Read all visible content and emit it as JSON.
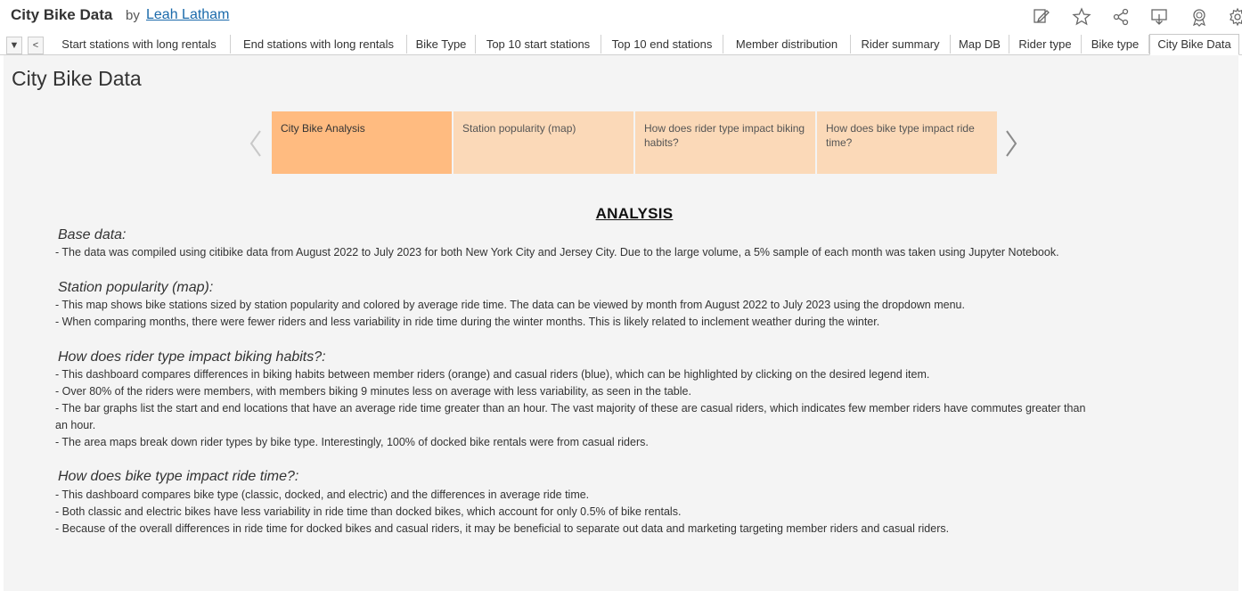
{
  "header": {
    "title": "City Bike Data",
    "by": "by",
    "author": "Leah Latham"
  },
  "toolbar_icons": [
    "edit-icon",
    "star-icon",
    "share-icon",
    "download-icon",
    "award-icon",
    "settings-icon"
  ],
  "tabs": [
    {
      "label": "Start stations with long rentals"
    },
    {
      "label": "End stations with long rentals"
    },
    {
      "label": "Bike Type"
    },
    {
      "label": "Top 10 start stations"
    },
    {
      "label": "Top 10 end stations"
    },
    {
      "label": "Member distribution"
    },
    {
      "label": "Rider summary"
    },
    {
      "label": "Map DB"
    },
    {
      "label": "Rider type"
    },
    {
      "label": "Bike type"
    },
    {
      "label": "City Bike Data",
      "active": true
    }
  ],
  "tab_controls": {
    "menu": "▼",
    "prev": "<"
  },
  "dashboard": {
    "title": "City Bike Data",
    "story_points": [
      {
        "label": "City Bike Analysis",
        "active": true
      },
      {
        "label": "Station popularity (map)"
      },
      {
        "label": "How does rider type impact biking habits?"
      },
      {
        "label": "How does bike type impact ride time?"
      }
    ],
    "analysis": {
      "heading": "ANALYSIS",
      "sections": [
        {
          "title": "Base data:",
          "lines": [
            "-  The data was compiled using citibike data from August 2022 to July 2023 for both New York City and Jersey City.  Due to the large volume, a 5% sample of each month was taken using Jupyter Notebook."
          ]
        },
        {
          "title": "Station popularity (map):",
          "lines": [
            "-  This map shows bike stations sized by station popularity and colored by average ride time. The data can be viewed by month from August 2022 to July 2023 using the dropdown menu.",
            "-  When comparing months, there were fewer riders and less variability in ride time during the winter months. This is likely related to inclement weather during the winter."
          ]
        },
        {
          "title": "How does rider type impact biking habits?:",
          "lines": [
            "-  This dashboard compares differences in biking habits between member riders (orange) and casual riders (blue), which can be highlighted by clicking on the desired legend item.",
            "-  Over 80% of the riders were members, with members biking 9 minutes less on average with less variability, as seen in the table.",
            "-  The bar graphs list the start and end locations that have an average ride time greater than an hour.  The vast majority of these are casual riders, which indicates few member riders have commutes greater than",
            "an hour.",
            "-  The area maps break down rider types by bike type.  Interestingly, 100% of docked bike rentals were from casual riders."
          ]
        },
        {
          "title": "How does bike type impact ride time?:",
          "lines": [
            "-  This dashboard compares bike type (classic, docked, and electric) and the differences in average ride time.",
            "-  Both classic and electric bikes have less variability in ride time than docked bikes, which account for only 0.5% of bike rentals.",
            "-  Because of the overall differences in ride time for docked bikes and casual riders, it may be beneficial to separate out data and marketing targeting member riders and casual riders."
          ]
        }
      ]
    }
  },
  "colors": {
    "story_active": "#ffbb80",
    "story_inactive": "#fbd9b8",
    "canvas_bg": "#f4f4f4",
    "link": "#1a6aab"
  }
}
